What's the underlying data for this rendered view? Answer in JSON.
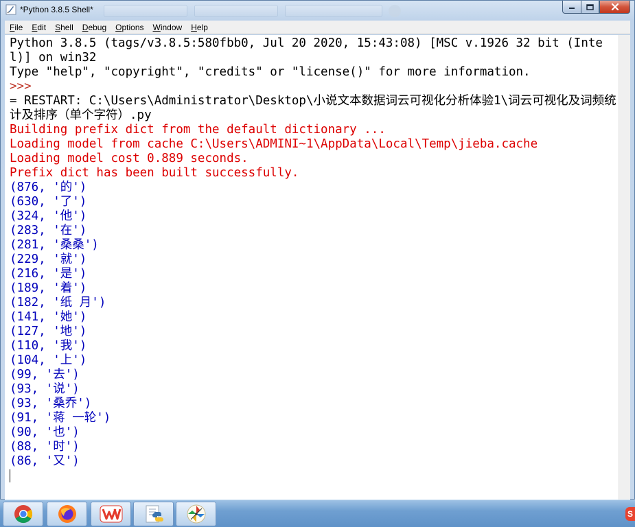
{
  "window": {
    "title": "*Python 3.8.5 Shell*"
  },
  "menu": [
    "File",
    "Edit",
    "Shell",
    "Debug",
    "Options",
    "Window",
    "Help"
  ],
  "shell": {
    "lines": [
      {
        "text": "Python 3.8.5 (tags/v3.8.5:580fbb0, Jul 20 2020, 15:43:08) [MSC v.1926 32 bit (Intel)] on win32",
        "kind": "normal",
        "wrap": true
      },
      {
        "text": "Type \"help\", \"copyright\", \"credits\" or \"license()\" for more information.",
        "kind": "normal"
      },
      {
        "text": ">>> ",
        "kind": "prompt"
      },
      {
        "text": "= RESTART: C:\\Users\\Administrator\\Desktop\\小说文本数据词云可视化分析体验1\\词云可视化及词频统计及排序（单个字符）.py",
        "kind": "normal",
        "wrap": true
      },
      {
        "text": "Building prefix dict from the default dictionary ...",
        "kind": "err"
      },
      {
        "text": "Loading model from cache C:\\Users\\ADMINI~1\\AppData\\Local\\Temp\\jieba.cache",
        "kind": "err"
      },
      {
        "text": "Loading model cost 0.889 seconds.",
        "kind": "err"
      },
      {
        "text": "Prefix dict has been built successfully.",
        "kind": "err"
      },
      {
        "text": "(876, '的')",
        "kind": "stdout"
      },
      {
        "text": "(630, '了')",
        "kind": "stdout"
      },
      {
        "text": "(324, '他')",
        "kind": "stdout"
      },
      {
        "text": "(283, '在')",
        "kind": "stdout"
      },
      {
        "text": "(281, '桑桑')",
        "kind": "stdout"
      },
      {
        "text": "(229, '就')",
        "kind": "stdout"
      },
      {
        "text": "(216, '是')",
        "kind": "stdout"
      },
      {
        "text": "(189, '着')",
        "kind": "stdout"
      },
      {
        "text": "(182, '纸 月')",
        "kind": "stdout"
      },
      {
        "text": "(141, '她')",
        "kind": "stdout"
      },
      {
        "text": "(127, '地')",
        "kind": "stdout"
      },
      {
        "text": "(110, '我')",
        "kind": "stdout"
      },
      {
        "text": "(104, '上')",
        "kind": "stdout"
      },
      {
        "text": "(99, '去')",
        "kind": "stdout"
      },
      {
        "text": "(93, '说')",
        "kind": "stdout"
      },
      {
        "text": "(93, '桑乔')",
        "kind": "stdout"
      },
      {
        "text": "(91, '蒋 一轮')",
        "kind": "stdout"
      },
      {
        "text": "(90, '也')",
        "kind": "stdout"
      },
      {
        "text": "(88, '时')",
        "kind": "stdout"
      },
      {
        "text": "(86, '又')",
        "kind": "stdout"
      }
    ]
  },
  "taskbar": {
    "apps": [
      {
        "name": "chrome",
        "icon": "chrome-icon",
        "active": true
      },
      {
        "name": "firefox",
        "icon": "firefox-icon",
        "active": true
      },
      {
        "name": "wps",
        "icon": "wps-icon",
        "active": true
      },
      {
        "name": "python-idle",
        "icon": "python-idle-icon",
        "active": true
      },
      {
        "name": "pinwheel-app",
        "icon": "pinwheel-icon",
        "active": true
      }
    ],
    "tray_badge": "S"
  },
  "colors": {
    "stdout": "#0000bb",
    "stderr": "#dd0000",
    "prompt": "#c0392b"
  }
}
